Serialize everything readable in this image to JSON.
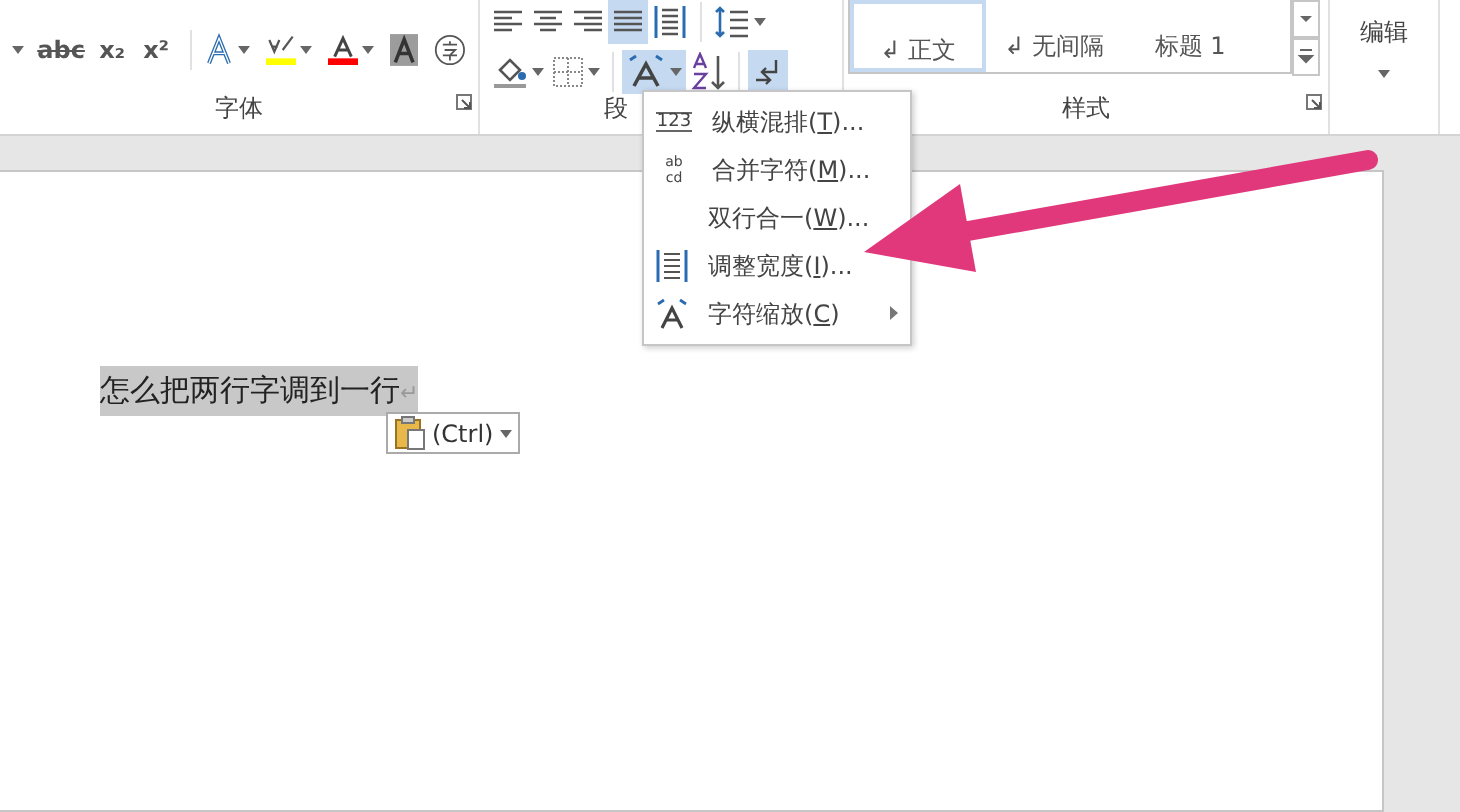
{
  "ribbon": {
    "font_group": {
      "label": "字体",
      "buttons": [
        {
          "kind": "caret",
          "selected": false
        },
        {
          "kind": "strike",
          "glyph": "abc",
          "selected": false
        },
        {
          "kind": "glyph",
          "glyph": "x₂",
          "selected": false
        },
        {
          "kind": "glyph",
          "glyph": "x²",
          "selected": false
        },
        {
          "kind": "sep"
        },
        {
          "kind": "effects",
          "selected": false,
          "dropdown": true
        },
        {
          "kind": "highlight",
          "selected": false,
          "dropdown": true,
          "color": "#ffff00"
        },
        {
          "kind": "fontcolor",
          "selected": false,
          "dropdown": true,
          "color": "#ff0000"
        },
        {
          "kind": "shade",
          "selected": false
        },
        {
          "kind": "enclose",
          "selected": false
        }
      ]
    },
    "paragraph_group": {
      "label": "段",
      "row1": [
        {
          "kind": "align-left",
          "selected": false
        },
        {
          "kind": "align-center",
          "selected": false
        },
        {
          "kind": "align-right",
          "selected": false
        },
        {
          "kind": "justify",
          "selected": true
        },
        {
          "kind": "distribute",
          "selected": false
        },
        {
          "kind": "sep"
        },
        {
          "kind": "spacing",
          "selected": false,
          "dropdown": true
        }
      ],
      "row2": [
        {
          "kind": "fill",
          "selected": false,
          "dropdown": true
        },
        {
          "kind": "borders",
          "selected": false,
          "dropdown": true
        },
        {
          "kind": "sep"
        },
        {
          "kind": "asian",
          "selected": true,
          "dropdown": true
        },
        {
          "kind": "sort",
          "selected": false
        },
        {
          "kind": "sep"
        },
        {
          "kind": "rtl",
          "selected": true
        }
      ]
    },
    "styles_group": {
      "label": "样式",
      "items": [
        {
          "name": "正文",
          "mark": "↲",
          "selected": true
        },
        {
          "name": "无间隔",
          "mark": "↲",
          "selected": false
        },
        {
          "name": "标题 1",
          "selected": false
        }
      ]
    },
    "editing": {
      "label": "编辑"
    }
  },
  "menu": {
    "items": [
      {
        "kind": "vertical",
        "icon_glyph": [
          "123"
        ],
        "before": "纵横混排(",
        "accel": "T",
        "after": ")...",
        "submenu": false
      },
      {
        "kind": "combine",
        "icon_glyph": [
          "ab",
          "cd"
        ],
        "before": "合并字符(",
        "accel": "M",
        "after": ")...",
        "submenu": false
      },
      {
        "kind": "none",
        "before": "双行合一(",
        "accel": "W",
        "after": ")...",
        "submenu": false
      },
      {
        "kind": "fit",
        "before": "调整宽度(",
        "accel": "I",
        "after": ")...",
        "submenu": false
      },
      {
        "kind": "scale",
        "before": "字符缩放(",
        "accel": "C",
        "after": ")",
        "submenu": true
      }
    ]
  },
  "document": {
    "text": "怎么把两行字调到一行",
    "mark": "↵",
    "selected": true
  },
  "paste_options": {
    "label": "(Ctrl)"
  }
}
